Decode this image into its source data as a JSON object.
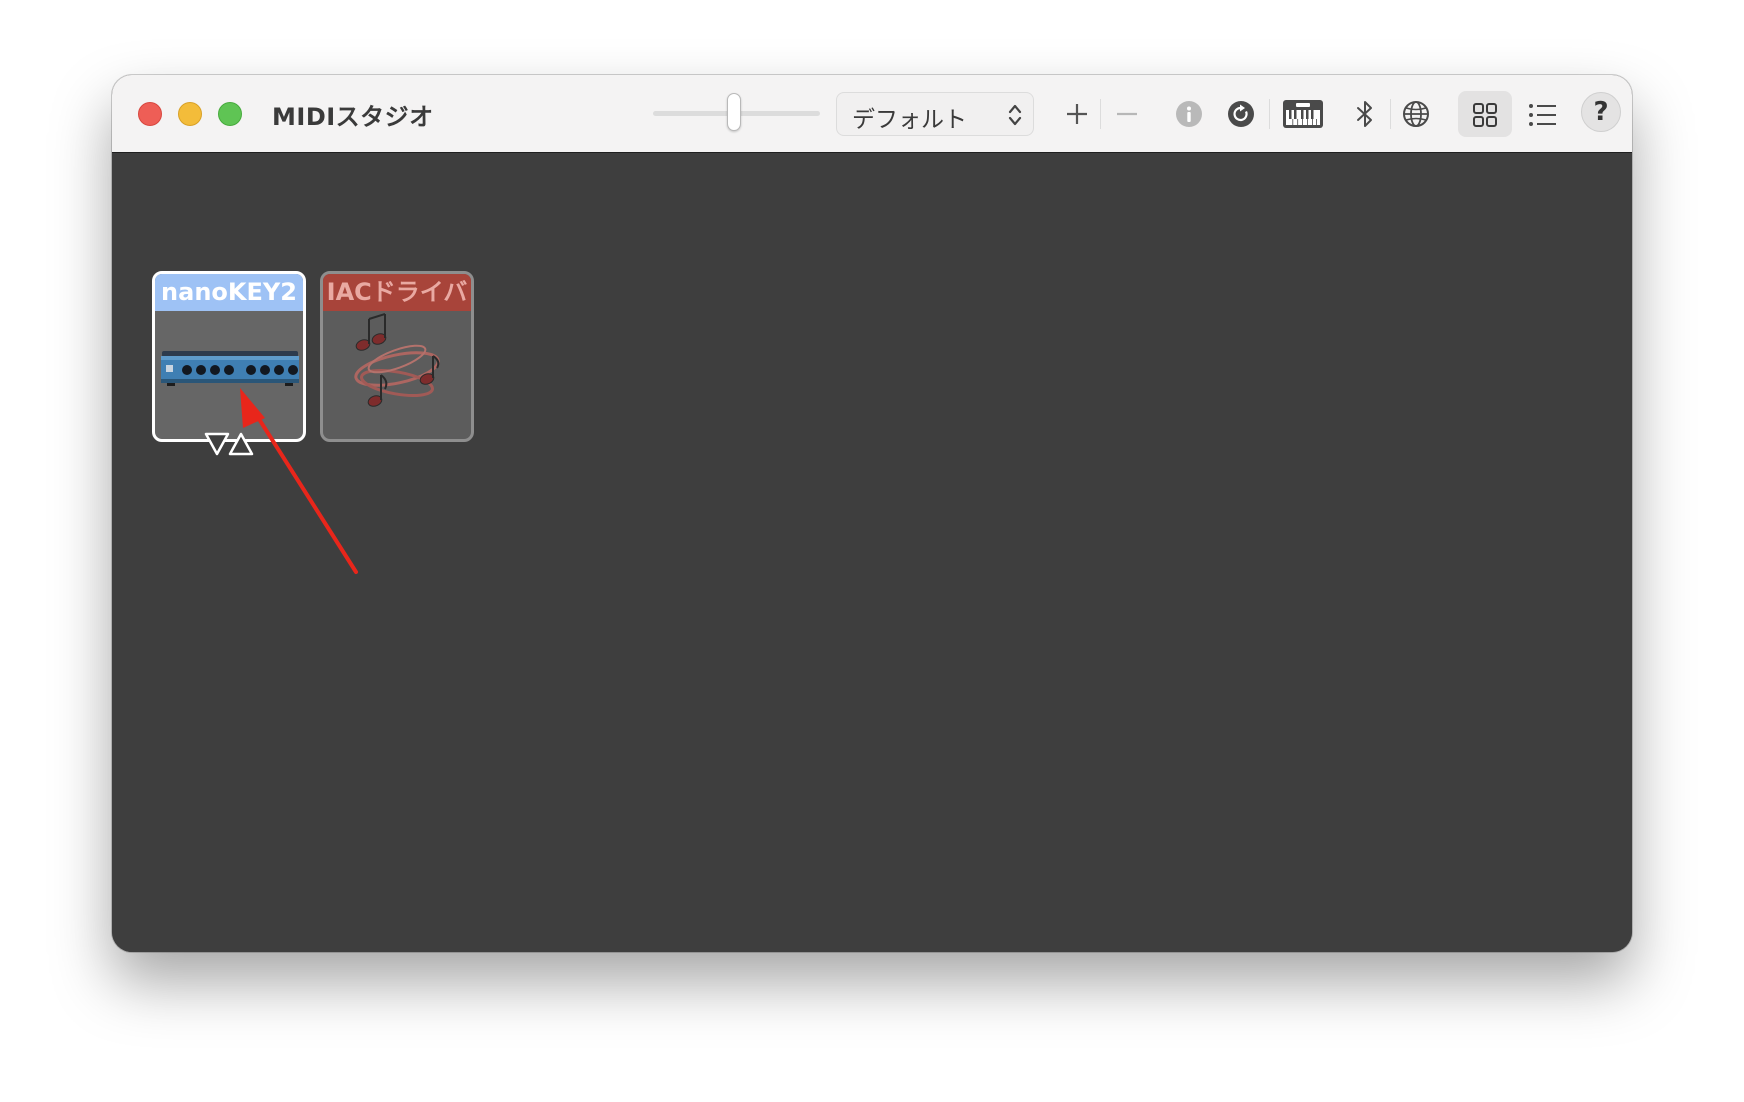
{
  "window": {
    "title": "MIDIスタジオ"
  },
  "toolbar": {
    "configuration": "デフォルト",
    "add_icon": "plus-icon",
    "remove_icon": "minus-icon",
    "info_icon": "info-icon",
    "rescan_icon": "rescan-icon",
    "test_setup_icon": "keyboard-icon",
    "bluetooth_icon": "bluetooth-icon",
    "network_icon": "globe-icon",
    "icon_view_icon": "grid-icon",
    "list_view_icon": "list-icon",
    "help_label": "?"
  },
  "devices": [
    {
      "name": "nanoKEY2",
      "selected": true
    },
    {
      "name": "IACドライバ",
      "selected": false
    }
  ],
  "annotation": {
    "color": "#e8261b"
  }
}
